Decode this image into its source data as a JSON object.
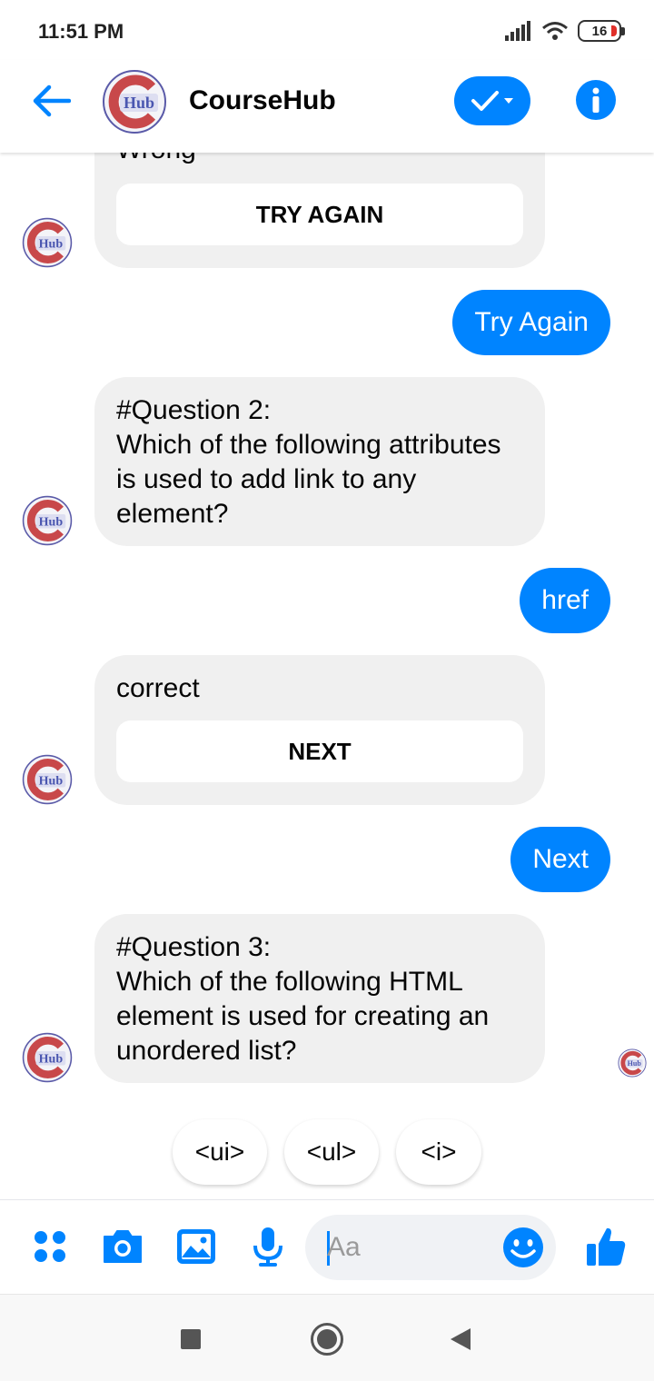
{
  "status_bar": {
    "time": "11:51 PM",
    "battery": "16"
  },
  "header": {
    "title": "CourseHub",
    "avatar_text": "Hub"
  },
  "messages": {
    "wrong_partial": "Wrong",
    "try_again_button": "TRY AGAIN",
    "user_try_again": "Try Again",
    "question2": "#Question 2:\nWhich of the following attributes is used to add link to any element?",
    "user_href": "href",
    "correct": "correct",
    "next_button": "NEXT",
    "user_next": "Next",
    "question3": "#Question 3:\nWhich of the following HTML element is used for creating an unordered list?"
  },
  "quick_replies": [
    "<ui>",
    "<ul>",
    "<i>"
  ],
  "composer": {
    "placeholder": "Aa"
  },
  "colors": {
    "accent": "#0084ff",
    "incoming_bubble": "#f0f0f0",
    "battery_low": "#e0302a"
  },
  "icons": [
    "back-arrow-icon",
    "check-icon",
    "info-icon",
    "apps-icon",
    "camera-icon",
    "image-icon",
    "microphone-icon",
    "emoji-icon",
    "thumbs-up-icon",
    "nav-square-icon",
    "nav-circle-icon",
    "nav-triangle-icon"
  ]
}
